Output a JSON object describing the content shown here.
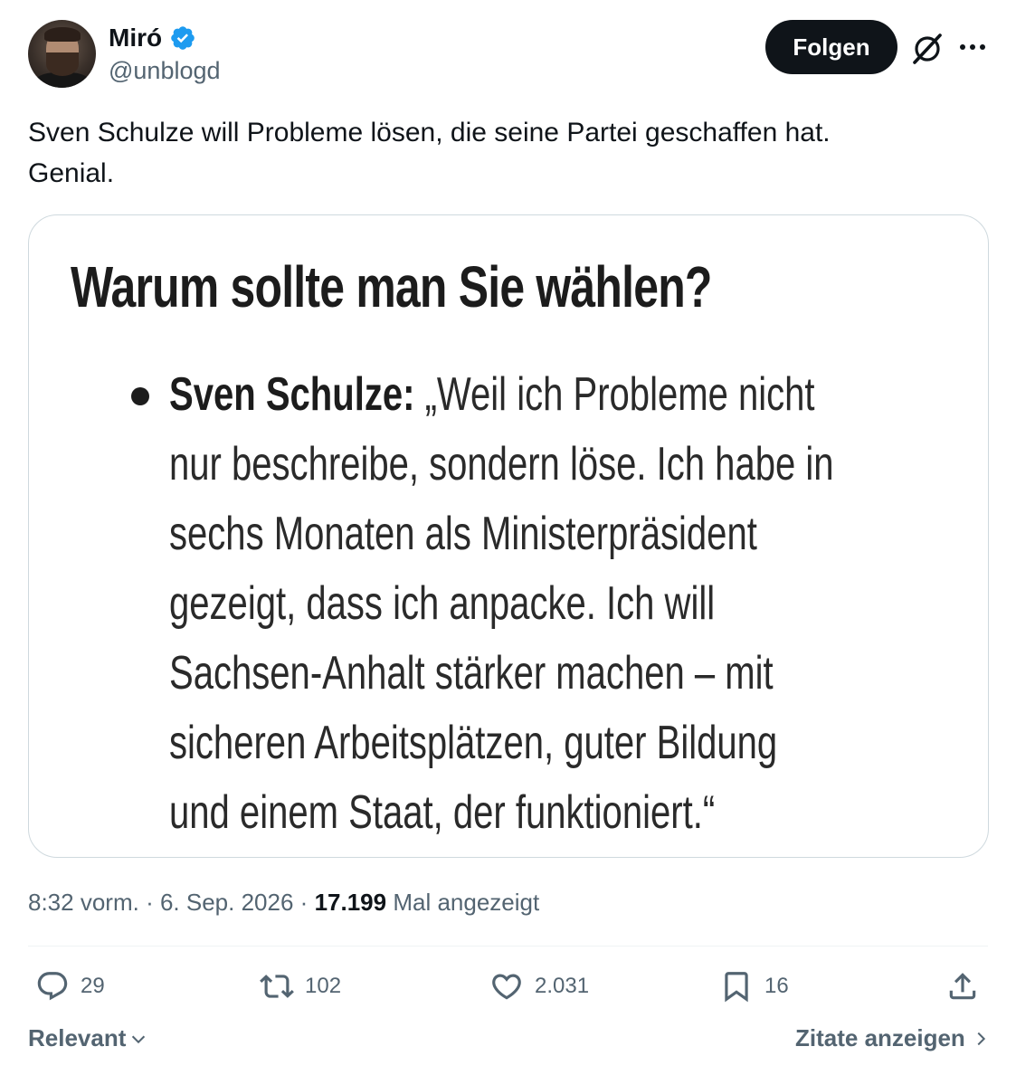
{
  "author": {
    "name": "Miró",
    "handle": "@unblogd",
    "verified": true
  },
  "header": {
    "follow_label": "Folgen"
  },
  "tweet": {
    "text_line1": "Sven Schulze will Probleme lösen, die seine Partei geschaffen hat.",
    "text_line2": "Genial."
  },
  "media": {
    "heading": "Warum sollte man Sie wählen?",
    "speaker": "Sven Schulze:",
    "quote_lines": [
      "„Weil ich Probleme nicht",
      "nur beschreibe, sondern löse. Ich habe in",
      "sechs Monaten als Ministerpräsident",
      "gezeigt, dass ich anpacke. Ich will",
      "Sachsen-Anhalt stärker machen – mit",
      "sicheren Arbeitsplätzen, guter Bildung",
      "und einem Staat, der funktioniert.“"
    ]
  },
  "meta": {
    "time": "8:32 vorm.",
    "separator": "·",
    "date": "6. Sep. 2026",
    "views": "17.199",
    "views_label": "Mal angezeigt"
  },
  "actions": {
    "replies": "29",
    "reposts": "102",
    "likes": "2.031",
    "bookmarks": "16"
  },
  "footer": {
    "sort_label": "Relevant",
    "quotes_label": "Zitate anzeigen"
  },
  "colors": {
    "verified_blue": "#1d9bf0",
    "follow_bg": "#0f1419",
    "secondary_text": "#536471"
  }
}
